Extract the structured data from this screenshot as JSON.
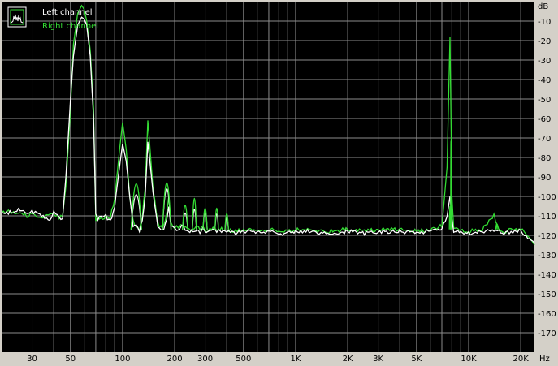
{
  "chart_data": {
    "type": "line",
    "title": "",
    "xlabel": "Hz",
    "ylabel": "dB",
    "x_scale": "log",
    "xlim": [
      20,
      24000
    ],
    "ylim": [
      -180,
      0
    ],
    "grid": true,
    "legend_placement": "top-left",
    "x_tick_labels": [
      {
        "value": 30,
        "label": "30"
      },
      {
        "value": 50,
        "label": "50"
      },
      {
        "value": 100,
        "label": "100"
      },
      {
        "value": 200,
        "label": "200"
      },
      {
        "value": 300,
        "label": "300"
      },
      {
        "value": 500,
        "label": "500"
      },
      {
        "value": 1000,
        "label": "1K"
      },
      {
        "value": 2000,
        "label": "2K"
      },
      {
        "value": 3000,
        "label": "3K"
      },
      {
        "value": 5000,
        "label": "5K"
      },
      {
        "value": 10000,
        "label": "10K"
      },
      {
        "value": 20000,
        "label": "20K"
      }
    ],
    "y_ticks": [
      -10,
      -20,
      -30,
      -40,
      -50,
      -60,
      -70,
      -80,
      -90,
      -100,
      -110,
      -120,
      -130,
      -140,
      -150,
      -160,
      -170
    ],
    "colors": {
      "background": "#000000",
      "grid": "#8c8c8c",
      "frame": "#d4d0c8"
    },
    "series": [
      {
        "name": "Left channel",
        "color": "#ffffff",
        "x": [
          20,
          25,
          28,
          30,
          34,
          38,
          40,
          43,
          45,
          47,
          50,
          52,
          55,
          58,
          60,
          62,
          65,
          68,
          70,
          72,
          75,
          80,
          85,
          90,
          95,
          100,
          105,
          110,
          115,
          120,
          125,
          130,
          135,
          140,
          150,
          160,
          170,
          180,
          185,
          190,
          200,
          210,
          220,
          230,
          235,
          240,
          250,
          260,
          270,
          280,
          290,
          300,
          310,
          320,
          340,
          350,
          360,
          380,
          400,
          420,
          440,
          460,
          480,
          500,
          550,
          600,
          700,
          800,
          900,
          1000,
          1200,
          1500,
          2000,
          2500,
          3000,
          3500,
          4000,
          5000,
          6000,
          7000,
          7500,
          7800,
          8000,
          8200,
          8500,
          9000,
          10000,
          12000,
          14000,
          15000,
          16000,
          18000,
          20000,
          22000,
          24000
        ],
        "y": [
          -109,
          -107,
          -109,
          -108,
          -110,
          -112,
          -108,
          -110,
          -112,
          -90,
          -50,
          -28,
          -12,
          -8,
          -9,
          -12,
          -28,
          -60,
          -108,
          -112,
          -110,
          -110,
          -113,
          -105,
          -88,
          -73,
          -82,
          -100,
          -115,
          -114,
          -118,
          -112,
          -100,
          -72,
          -98,
          -116,
          -118,
          -112,
          -106,
          -115,
          -116,
          -118,
          -115,
          -117,
          -118,
          -117,
          -118,
          -118,
          -117,
          -118,
          -116,
          -118,
          -118,
          -118,
          -117,
          -118,
          -118,
          -118,
          -119,
          -118,
          -119,
          -119,
          -118,
          -118,
          -118,
          -119,
          -118,
          -119,
          -119,
          -118,
          -118,
          -119,
          -118,
          -119,
          -118,
          -118,
          -118,
          -119,
          -118,
          -117,
          -110,
          -100,
          -112,
          -118,
          -118,
          -118,
          -119,
          -118,
          -118,
          -118,
          -119,
          -118,
          -118,
          -122,
          -124
        ]
      },
      {
        "name": "Right channel",
        "color": "#33dd33",
        "x": [
          20,
          25,
          28,
          30,
          34,
          38,
          40,
          43,
          45,
          47,
          50,
          52,
          55,
          58,
          60,
          62,
          65,
          68,
          70,
          72,
          75,
          80,
          85,
          90,
          95,
          100,
          105,
          110,
          115,
          120,
          125,
          130,
          135,
          140,
          150,
          160,
          170,
          180,
          185,
          190,
          200,
          210,
          220,
          230,
          235,
          240,
          250,
          260,
          270,
          280,
          290,
          300,
          310,
          320,
          340,
          350,
          360,
          380,
          400,
          420,
          440,
          460,
          480,
          500,
          550,
          600,
          700,
          800,
          900,
          1000,
          1200,
          1500,
          2000,
          2500,
          3000,
          3500,
          4000,
          5000,
          6000,
          7000,
          7500,
          7800,
          8000,
          8200,
          8500,
          9000,
          10000,
          12000,
          14000,
          15000,
          16000,
          18000,
          20000,
          22000,
          24000
        ],
        "y": [
          -108,
          -108,
          -110,
          -109,
          -111,
          -110,
          -109,
          -111,
          -110,
          -95,
          -55,
          -22,
          -6,
          -2,
          -4,
          -10,
          -25,
          -55,
          -112,
          -110,
          -112,
          -111,
          -110,
          -102,
          -80,
          -62,
          -76,
          -100,
          -112,
          -116,
          -117,
          -110,
          -96,
          -61,
          -96,
          -114,
          -117,
          -109,
          -100,
          -114,
          -116,
          -116,
          -114,
          -116,
          -117,
          -116,
          -117,
          -117,
          -116,
          -117,
          -115,
          -117,
          -118,
          -117,
          -116,
          -117,
          -117,
          -117,
          -118,
          -117,
          -118,
          -118,
          -117,
          -117,
          -117,
          -118,
          -117,
          -118,
          -118,
          -117,
          -117,
          -118,
          -117,
          -118,
          -117,
          -117,
          -117,
          -118,
          -117,
          -115,
          -85,
          -18,
          -100,
          -117,
          -117,
          -117,
          -118,
          -117,
          -110,
          -117,
          -118,
          -117,
          -117,
          -120,
          -125
        ]
      }
    ],
    "peaks": [
      {
        "series": 0,
        "f": 120,
        "db": -73,
        "w": 0.03
      },
      {
        "series": 1,
        "f": 120,
        "db": -62,
        "w": 0.03
      },
      {
        "series": 0,
        "f": 180,
        "db": -67,
        "w": 0.025
      },
      {
        "series": 1,
        "f": 180,
        "db": -61,
        "w": 0.025
      },
      {
        "series": 0,
        "f": 230,
        "db": -92,
        "w": 0.015
      },
      {
        "series": 1,
        "f": 230,
        "db": -84,
        "w": 0.015
      },
      {
        "series": 0,
        "f": 260,
        "db": -88,
        "w": 0.012
      },
      {
        "series": 1,
        "f": 260,
        "db": -77,
        "w": 0.012
      },
      {
        "series": 0,
        "f": 300,
        "db": -90,
        "w": 0.012
      },
      {
        "series": 1,
        "f": 300,
        "db": -87,
        "w": 0.012
      },
      {
        "series": 0,
        "f": 350,
        "db": -93,
        "w": 0.01
      },
      {
        "series": 1,
        "f": 350,
        "db": -87,
        "w": 0.01
      },
      {
        "series": 0,
        "f": 400,
        "db": -97,
        "w": 0.01
      },
      {
        "series": 1,
        "f": 400,
        "db": -92,
        "w": 0.01
      },
      {
        "series": 1,
        "f": 7800,
        "db": -85,
        "w": 0.004
      },
      {
        "series": 1,
        "f": 7900,
        "db": -18,
        "w": 0.002
      },
      {
        "series": 1,
        "f": 14500,
        "db": -103,
        "w": 0.004
      }
    ]
  },
  "legend": {
    "items": [
      "Left channel",
      "Right channel"
    ]
  },
  "axis_labels": {
    "y_unit": "dB",
    "x_unit": "Hz"
  }
}
